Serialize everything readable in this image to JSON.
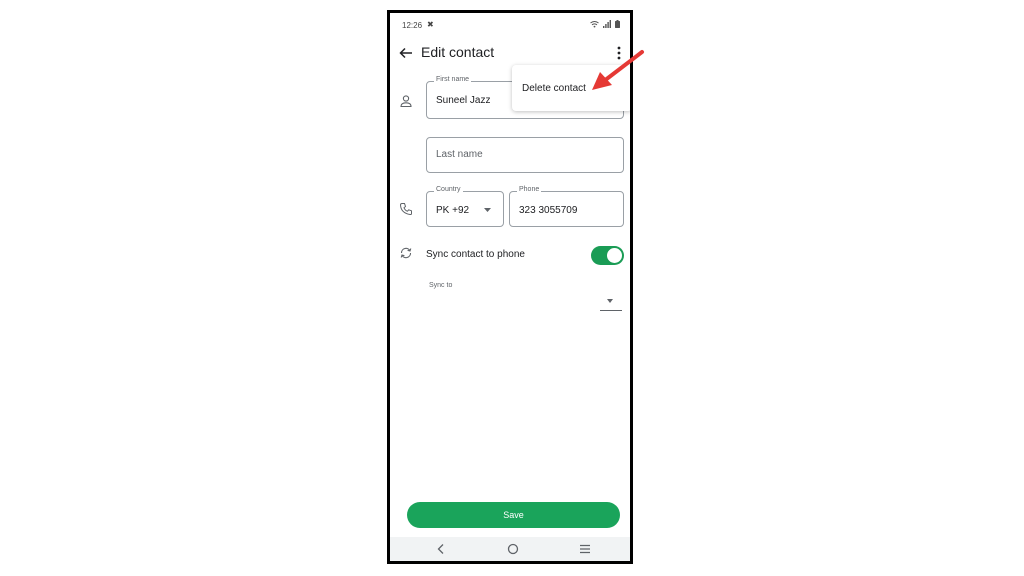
{
  "status_bar": {
    "time": "12:26"
  },
  "appbar": {
    "title": "Edit contact"
  },
  "menu": {
    "delete_label": "Delete contact"
  },
  "form": {
    "first_name_label": "First name",
    "first_name_value": "Suneel Jazz",
    "last_name_placeholder": "Last name",
    "country_label": "Country",
    "country_value": "PK +92",
    "phone_label": "Phone",
    "phone_value": "323 3055709",
    "sync_label": "Sync contact to phone",
    "sync_enabled": true,
    "sync_to_label": "Sync to"
  },
  "buttons": {
    "save_label": "Save"
  },
  "colors": {
    "accent": "#1aa45b",
    "toggle": "#1a9c55",
    "annotation_arrow": "#e53935"
  }
}
